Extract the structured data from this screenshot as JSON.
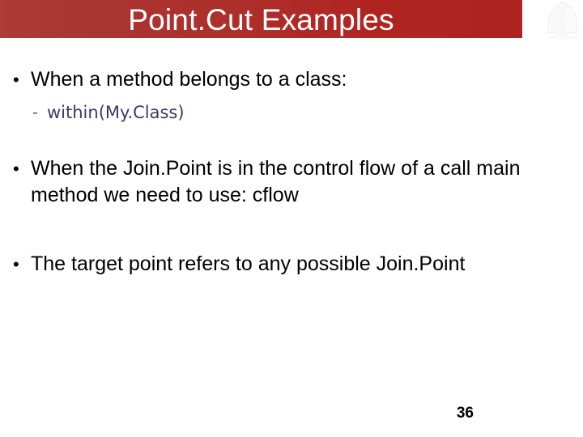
{
  "slide": {
    "title": "Point.Cut Examples",
    "page_number": "36",
    "background_color": "#ffffff",
    "banner": {
      "gradient_from": "#ae3b36",
      "gradient_to": "#ac2320",
      "title_color": "#ffffff"
    },
    "logo": {
      "name": "university-crest-logo",
      "tint": "#d8d8d8"
    },
    "bullets": [
      {
        "text": "When a method belongs to a class:",
        "justified": false,
        "sub_bullets": [
          {
            "dash": "-",
            "text": "within(My.Class)",
            "color": "#3b3b6b"
          }
        ]
      },
      {
        "text": "When the Join.Point is in the control flow of a call main method we need to use: cflow",
        "justified": false,
        "sub_bullets": []
      },
      {
        "text": "The target point refers to any possible Join.Point",
        "justified": true,
        "sub_bullets": []
      }
    ]
  }
}
